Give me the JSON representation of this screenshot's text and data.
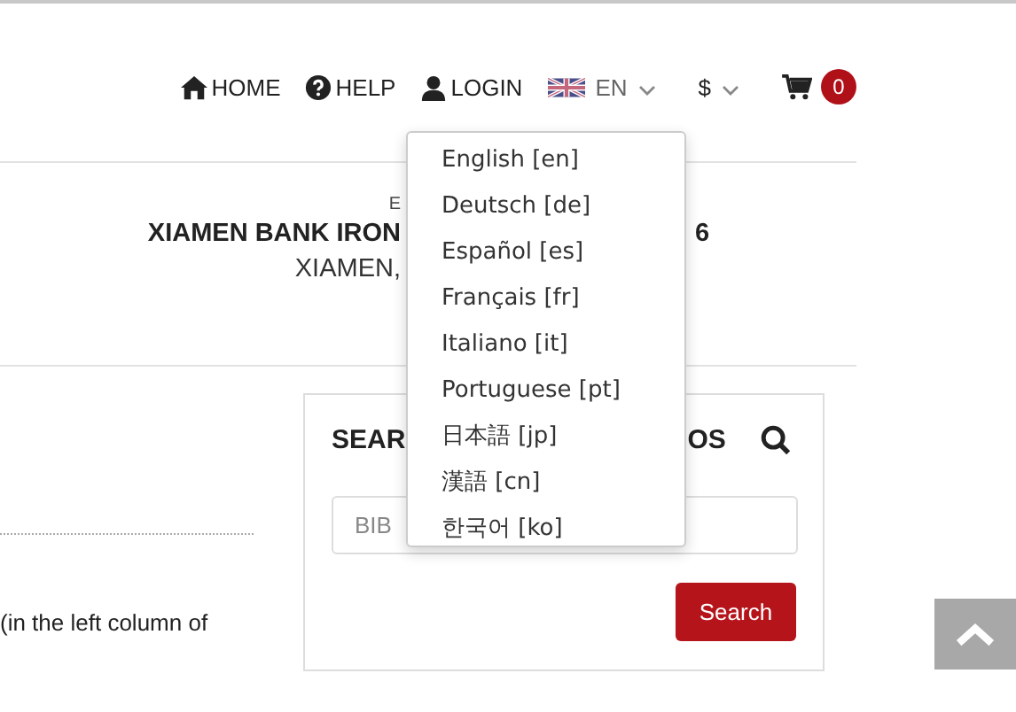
{
  "nav": [
    {
      "kind": "home",
      "label": "HOME"
    },
    {
      "kind": "help",
      "label": "HELP"
    },
    {
      "kind": "login",
      "label": "LOGIN"
    }
  ],
  "language": {
    "code": "EN",
    "expanded": true
  },
  "currency": {
    "symbol": "$"
  },
  "cart": {
    "count": "0"
  },
  "language_menu": [
    "English [en]",
    "Deutsch [de]",
    "Español [es]",
    "Français [fr]",
    "Italiano [it]",
    "Portuguese [pt]",
    "日本語 [jp]",
    "漢語 [cn]",
    "한국어 [ko]"
  ],
  "event": {
    "label": "E",
    "title_start": "XIAMEN BANK IRON",
    "title_end": "6",
    "location": "XIAMEN,"
  },
  "intro_text": "(in the left column of",
  "search_card": {
    "title_start": "SEAR",
    "title_end": "OS",
    "placeholder": "BIB",
    "button": "Search"
  }
}
